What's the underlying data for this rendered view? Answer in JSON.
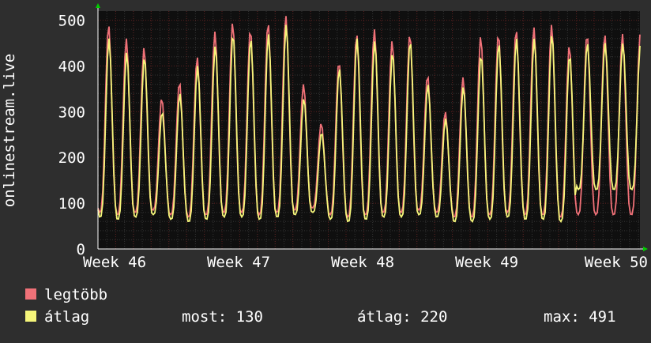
{
  "colors": {
    "background": "#2e2e2e",
    "plot_background": "#0f0f0f",
    "grid_major": "#5a1e1e",
    "grid_minor": "#333333",
    "text": "#ffffff",
    "max_series": "#f07178",
    "avg_series": "#f5f57a",
    "axis_arrow": "#00cc00"
  },
  "chart_data": {
    "type": "line",
    "ylabel": "onlinestream.live",
    "ylim": [
      0,
      520
    ],
    "yticks": [
      0,
      100,
      200,
      300,
      400,
      500
    ],
    "x_tick_labels": [
      "Week 46",
      "Week 47",
      "Week 48",
      "Week 49",
      "Week 50"
    ],
    "grid": true,
    "days": 28,
    "daily_peaks_max": [
      490,
      460,
      440,
      330,
      365,
      420,
      475,
      495,
      480,
      495,
      510,
      360,
      275,
      410,
      470,
      480,
      455,
      470,
      380,
      300,
      375,
      465,
      470,
      480,
      485,
      490,
      445,
      470
    ],
    "daily_peaks_avg": [
      460,
      430,
      420,
      300,
      340,
      400,
      445,
      470,
      460,
      470,
      490,
      330,
      255,
      395,
      460,
      455,
      430,
      455,
      360,
      285,
      355,
      425,
      450,
      460,
      460,
      470,
      425,
      450
    ],
    "daily_min_max": [
      80,
      75,
      80,
      85,
      75,
      70,
      75,
      80,
      80,
      75,
      80,
      85,
      90,
      75,
      70,
      75,
      80,
      80,
      85,
      80,
      70,
      70,
      75,
      80,
      75,
      75,
      70,
      75
    ],
    "daily_min_avg": [
      70,
      65,
      70,
      75,
      65,
      60,
      65,
      70,
      70,
      65,
      70,
      75,
      80,
      65,
      60,
      65,
      70,
      70,
      75,
      70,
      60,
      60,
      65,
      70,
      65,
      65,
      60,
      130
    ],
    "series": [
      {
        "name": "legtöbb",
        "color": "#f07178"
      },
      {
        "name": "átlag",
        "color": "#f5f57a"
      }
    ]
  },
  "legend": {
    "max_label": "legtöbb",
    "avg_label": "átlag",
    "stats": {
      "current": "most: 130",
      "average": "átlag: 220",
      "max": "max: 491"
    }
  }
}
